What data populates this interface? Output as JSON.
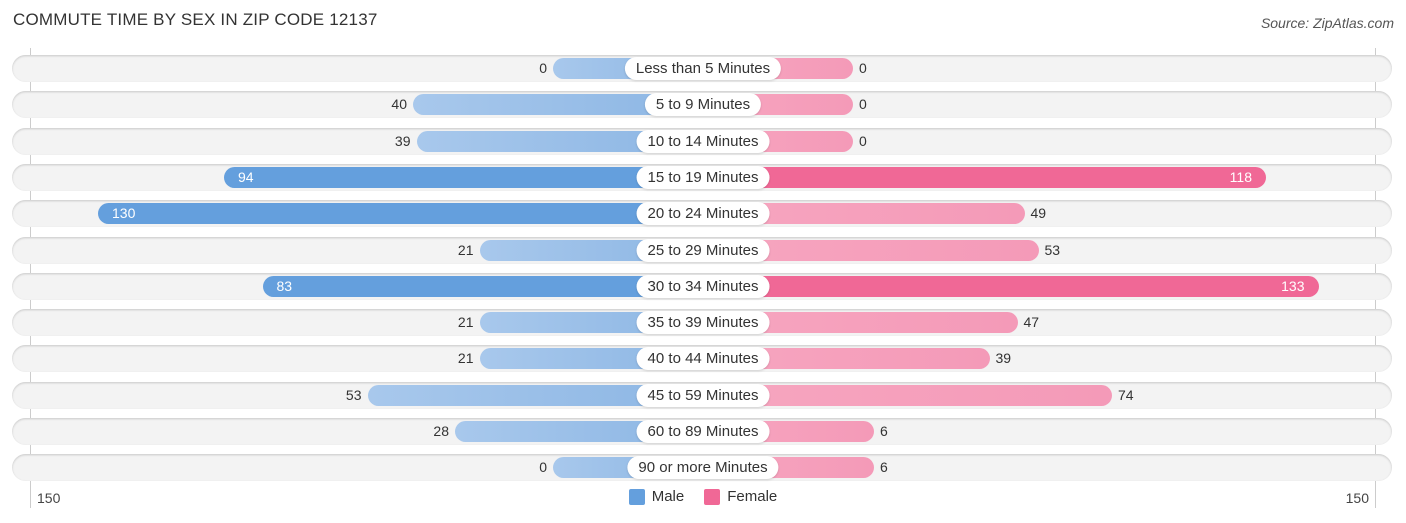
{
  "title": "COMMUTE TIME BY SEX IN ZIP CODE 12137",
  "source": "Source: ZipAtlas.com",
  "chart_data": {
    "type": "bar",
    "orientation": "horizontal-diverging",
    "title": "COMMUTE TIME BY SEX IN ZIP CODE 12137",
    "categories": [
      "Less than 5 Minutes",
      "5 to 9 Minutes",
      "10 to 14 Minutes",
      "15 to 19 Minutes",
      "20 to 24 Minutes",
      "25 to 29 Minutes",
      "30 to 34 Minutes",
      "35 to 39 Minutes",
      "40 to 44 Minutes",
      "45 to 59 Minutes",
      "60 to 89 Minutes",
      "90 or more Minutes"
    ],
    "series": [
      {
        "name": "Male",
        "color": "#649fdd",
        "values": [
          0,
          40,
          39,
          94,
          130,
          21,
          83,
          21,
          21,
          53,
          28,
          0
        ]
      },
      {
        "name": "Female",
        "color": "#f06896",
        "values": [
          0,
          0,
          0,
          118,
          49,
          53,
          133,
          47,
          39,
          74,
          6,
          6
        ]
      }
    ],
    "axis": {
      "left_tick": "150",
      "right_tick": "150",
      "max": 150
    },
    "legend": {
      "position": "bottom-center",
      "items": [
        "Male",
        "Female"
      ]
    }
  }
}
